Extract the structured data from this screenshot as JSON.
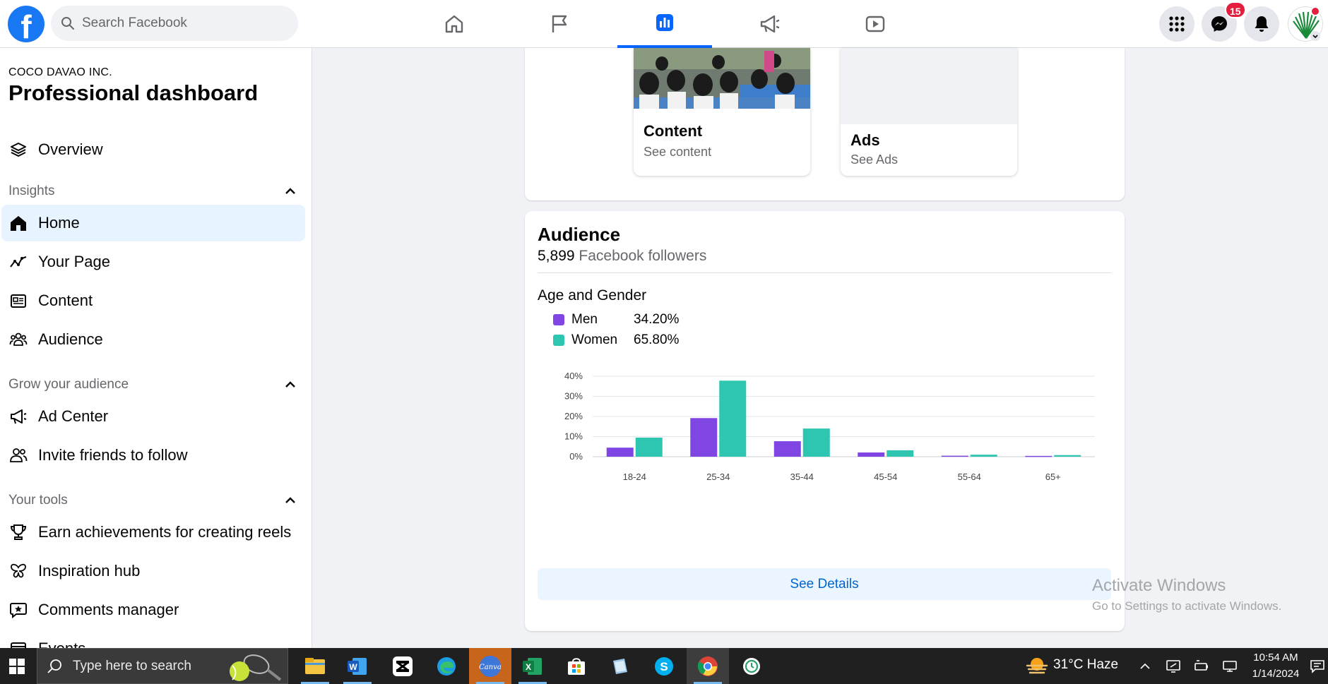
{
  "topbar": {
    "search_placeholder": "Search Facebook",
    "notification_badge": "15",
    "nav_tabs": [
      "home",
      "pages",
      "professional-dashboard",
      "ads",
      "video"
    ],
    "active_tab": "professional-dashboard",
    "brand_color": "#1877f2"
  },
  "sidebar": {
    "subtitle": "COCO DAVAO INC.",
    "title": "Professional dashboard",
    "overview": "Overview",
    "sections": {
      "insights": "Insights",
      "grow": "Grow your audience",
      "tools": "Your tools"
    },
    "insights_items": [
      {
        "label": "Home",
        "icon": "home-icon"
      },
      {
        "label": "Your Page",
        "icon": "trend-icon"
      },
      {
        "label": "Content",
        "icon": "content-icon"
      },
      {
        "label": "Audience",
        "icon": "people-icon"
      }
    ],
    "grow_items": [
      {
        "label": "Ad Center",
        "icon": "megaphone-icon"
      },
      {
        "label": "Invite friends to follow",
        "icon": "invite-icon"
      }
    ],
    "tools_items": [
      {
        "label": "Earn achievements for creating reels",
        "icon": "trophy-icon"
      },
      {
        "label": "Inspiration hub",
        "icon": "butterfly-icon"
      },
      {
        "label": "Comments manager",
        "icon": "comment-star-icon"
      },
      {
        "label": "Events",
        "icon": "calendar-icon"
      }
    ]
  },
  "top_cards": {
    "content": {
      "title": "Content",
      "subtitle": "See content"
    },
    "ads": {
      "title": "Ads",
      "subtitle": "See Ads"
    }
  },
  "audience": {
    "title": "Audience",
    "follower_count": "5,899",
    "follower_label": "Facebook followers",
    "age_gender_title": "Age and Gender",
    "see_details": "See Details"
  },
  "chart_data": {
    "type": "bar",
    "categories": [
      "18-24",
      "25-34",
      "35-44",
      "45-54",
      "55-64",
      "65+"
    ],
    "series": [
      {
        "name": "Men",
        "share": "34.20%",
        "color": "#8046e3",
        "values": [
          4.5,
          19.2,
          7.7,
          2.1,
          0.5,
          0.4
        ]
      },
      {
        "name": "Women",
        "share": "65.80%",
        "color": "#2fc6b1",
        "values": [
          9.5,
          37.8,
          14.0,
          3.2,
          1.0,
          0.8
        ]
      }
    ],
    "yticks": [
      "0%",
      "10%",
      "20%",
      "30%",
      "40%"
    ],
    "ylim": [
      0,
      40
    ],
    "grid": true,
    "legend": "top-left"
  },
  "watermark": {
    "line1": "Activate Windows",
    "line2": "Go to Settings to activate Windows."
  },
  "taskbar": {
    "search_placeholder": "Type here to search",
    "weather": "31°C  Haze",
    "time": "10:54 AM",
    "date": "1/14/2024",
    "apps": [
      "file-explorer-icon",
      "word-icon",
      "capcut-icon",
      "edge-icon",
      "canva-icon",
      "excel-icon",
      "store-icon",
      "notes-icon",
      "skype-icon",
      "chrome-icon",
      "clock-app-icon"
    ]
  }
}
